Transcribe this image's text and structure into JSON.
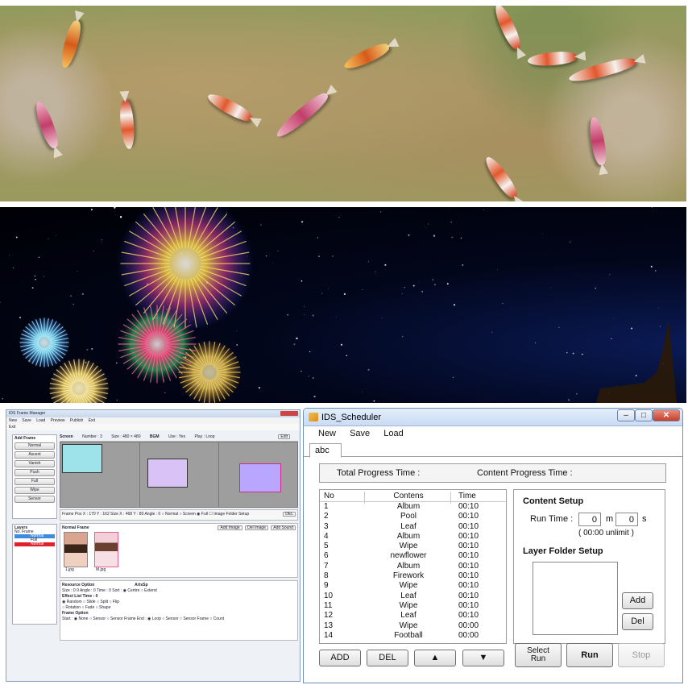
{
  "scheduler": {
    "title": "IDS_Scheduler",
    "window_controls": {
      "min": "–",
      "max": "□",
      "close": "✕"
    },
    "menu": [
      "New",
      "Save",
      "Load"
    ],
    "tab": "abc",
    "total_progress_label": "Total Progress Time :",
    "content_progress_label": "Content Progress Time :",
    "columns": [
      "No",
      "Contens",
      "Time"
    ],
    "rows": [
      [
        "1",
        "Album",
        "00:10"
      ],
      [
        "2",
        "Pool",
        "00:10"
      ],
      [
        "3",
        "Leaf",
        "00:10"
      ],
      [
        "4",
        "Album",
        "00:10"
      ],
      [
        "5",
        "Wipe",
        "00:10"
      ],
      [
        "6",
        "newflower",
        "00:10"
      ],
      [
        "7",
        "Album",
        "00:10"
      ],
      [
        "8",
        "Firework",
        "00:10"
      ],
      [
        "9",
        "Wipe",
        "00:10"
      ],
      [
        "10",
        "Leaf",
        "00:10"
      ],
      [
        "11",
        "Wipe",
        "00:10"
      ],
      [
        "12",
        "Leaf",
        "00:10"
      ],
      [
        "13",
        "Wipe",
        "00:00"
      ],
      [
        "14",
        "Football",
        "00:00"
      ]
    ],
    "content_setup": {
      "heading": "Content Setup",
      "run_time_label": "Run Time :",
      "minutes": "0",
      "minutes_unit": "m",
      "seconds": "0",
      "seconds_unit": "s",
      "unlimit_note": "( 00:00 unlimit )"
    },
    "layer_folder_setup": {
      "heading": "Layer Folder Setup",
      "add": "Add",
      "del": "Del"
    },
    "buttons": {
      "add": "ADD",
      "del": "DEL",
      "up": "▲",
      "down": "▼",
      "select_run_1": "Select",
      "select_run_2": "Run",
      "run": "Run",
      "stop": "Stop"
    }
  },
  "frame_manager": {
    "title": "IDS Frame Manager",
    "menu": [
      "New",
      "Save",
      "Load",
      "Preview",
      "Publish",
      "Exit"
    ],
    "tab": "Exit",
    "add_frame_label": "Add Frame",
    "add_frame_buttons": [
      "Normal",
      "Ascent",
      "Vanish",
      "Push",
      "Full",
      "Wipe",
      "Sensor"
    ],
    "screen_bar": [
      "Screen",
      "Number : 3",
      "Size : 480 × 480",
      "BGM",
      "Use : Yes",
      "Play : Loop",
      "Edit"
    ],
    "frame_bar": "Frame   Pos X : 170   Y : 162   Size X : 468   Y : 80   Angle : 0   ○ Normal  ○ Screen  ◉ Full   ☐ Image Folder Setup",
    "frame_del": "DEL",
    "layers_label": "Layers",
    "layers_columns": "No.   Frame",
    "layers": [
      "Normal",
      "Full",
      "Normal"
    ],
    "normal_frame_label": "Normal Frame",
    "image_buttons": [
      "Add Image",
      "Del Image",
      "Add Sound"
    ],
    "thumbs": [
      "1.jpg",
      "M.jpg"
    ],
    "options": [
      "Resource Option                                    ArtsSp",
      "Size : 0   0   Angle : 0   Time : 0   Sort : ◉ Centre  ○ Extend",
      "Effect List   Time : 0",
      "◉ Random  ○ Slide  ○ Split  ○ Flip",
      "○ Rotation  ○ Fade  ○ Shape",
      "Frame Option",
      "Start : ◉ None  ○ Sensor  ○ Sensor Frame        End : ◉ Loop  ○ Sensor  ○ Sensor Frame   ○ Count"
    ]
  }
}
